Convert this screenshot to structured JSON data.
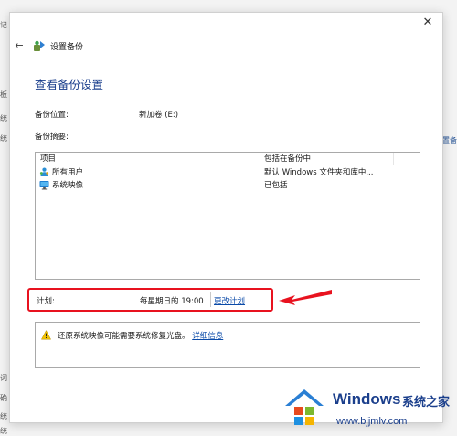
{
  "background": {
    "left_edge_chars": [
      "记",
      "板",
      "统",
      "统",
      "词",
      "确",
      "统",
      "统"
    ],
    "right_link": "设置备"
  },
  "dialog": {
    "close_glyph": "✕",
    "back_glyph": "←",
    "header_title": "设置备份",
    "page_title": "查看备份设置",
    "location_label": "备份位置:",
    "location_value": "新加卷 (E:)",
    "summary_label": "备份摘要:",
    "list": {
      "columns": [
        "项目",
        "包括在备份中"
      ],
      "rows": [
        {
          "item": "所有用户",
          "icon": "users-icon",
          "included": "默认 Windows 文件夹和库中..."
        },
        {
          "item": "系统映像",
          "icon": "monitor-icon",
          "included": "已包括"
        }
      ]
    },
    "schedule": {
      "label": "计划:",
      "value": "每星期日的 19:00",
      "link": "更改计划"
    },
    "warning": {
      "text": "还原系统映像可能需要系统修复光盘。",
      "link": "详细信息"
    }
  },
  "watermark": {
    "brand": "Windows",
    "brand_cn": "系统之家",
    "url": "www.bjjmlv.com"
  },
  "colors": {
    "title_blue": "#1a3e8c",
    "link_blue": "#0a4aa8",
    "highlight_red": "#e8121f"
  }
}
